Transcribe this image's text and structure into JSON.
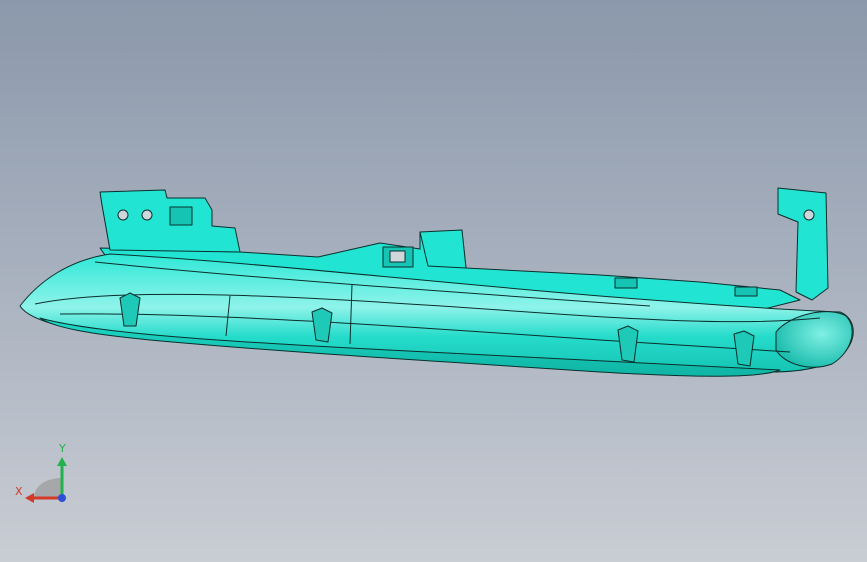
{
  "viewport": {
    "background_top": "#8b98ab",
    "background_bottom": "#c9cdd4"
  },
  "model": {
    "icon": "grille-trim-part-3d-model",
    "face_color": "#21e5d2",
    "highlight_color": "#9ff5ec",
    "edge_color": "#0a2f2c"
  },
  "triad": {
    "icon": "coordinate-axes-triad",
    "x_label": "X",
    "y_label": "Y",
    "x_color": "#d23a2a",
    "y_color": "#22b14c",
    "z_color": "#2a4fd6"
  }
}
